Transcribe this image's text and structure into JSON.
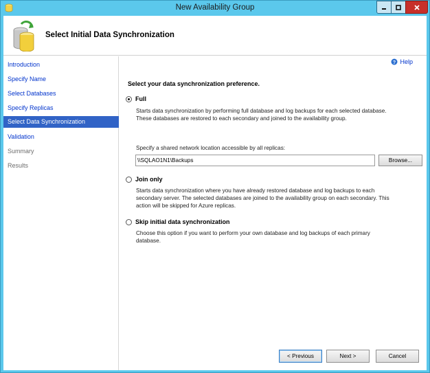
{
  "window": {
    "title": "New Availability Group"
  },
  "header": {
    "title": "Select Initial Data Synchronization"
  },
  "sidebar": {
    "items": [
      {
        "label": "Introduction",
        "state": "link"
      },
      {
        "label": "Specify Name",
        "state": "link"
      },
      {
        "label": "Select Databases",
        "state": "link"
      },
      {
        "label": "Specify Replicas",
        "state": "link"
      },
      {
        "label": "Select Data Synchronization",
        "state": "active"
      },
      {
        "label": "Validation",
        "state": "link"
      },
      {
        "label": "Summary",
        "state": "disabled"
      },
      {
        "label": "Results",
        "state": "disabled"
      }
    ]
  },
  "content": {
    "help_label": "Help",
    "prompt": "Select your data synchronization preference.",
    "options": [
      {
        "label": "Full",
        "checked": true,
        "description_lines": [
          "Starts data synchronization by performing full database and log backups for each selected database.",
          "These databases are restored to each secondary and joined to the availability group."
        ]
      },
      {
        "label": "Join only",
        "checked": false,
        "description_lines": [
          "Starts data synchronization where you have already restored database and log backups to each",
          "secondary server. The selected databases are joined to the availability group on each secondary. This",
          "action will be skipped for Azure replicas."
        ]
      },
      {
        "label": "Skip initial data synchronization",
        "checked": false,
        "description_lines": [
          "Choose this option if you want to perform your own database and log backups of each primary",
          "database."
        ]
      }
    ],
    "share_label": "Specify a shared network location accessible by all replicas:",
    "share_path": "\\\\SQLAO1N1\\Backups",
    "browse_label": "Browse..."
  },
  "footer": {
    "previous_label": "< Previous",
    "next_label": "Next >",
    "cancel_label": "Cancel"
  },
  "colors": {
    "window_frame": "#5bc8ec",
    "active_nav": "#3163c6",
    "link": "#0033cc",
    "close_button": "#c7302a"
  }
}
